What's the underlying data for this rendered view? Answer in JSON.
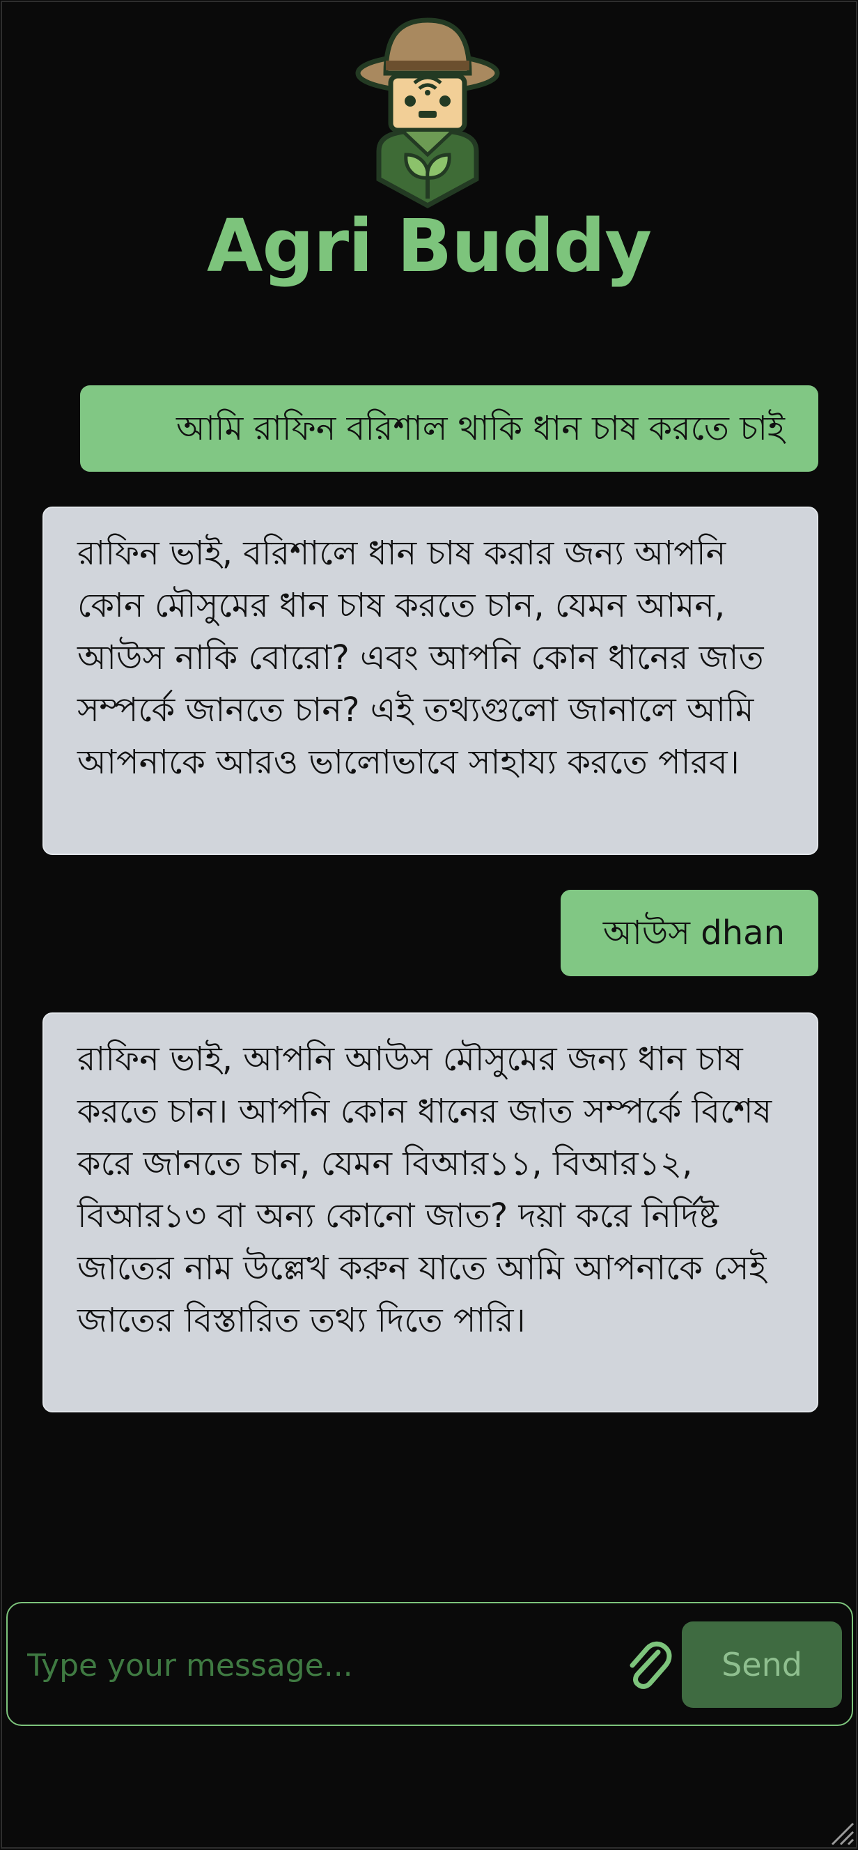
{
  "app": {
    "title": "Agri Buddy",
    "logo_icon": "farmer-robot-icon",
    "accent_color": "#7dc47c",
    "background_color": "#0a0a0a"
  },
  "messages": [
    {
      "role": "user",
      "text": "আমি রাফিন বরিশাল থাকি ধান চাষ করতে চাই"
    },
    {
      "role": "bot",
      "text": "রাফিন ভাই, বরিশালে ধান চাষ করার জন্য আপনি কোন মৌসুমের ধান চাষ করতে চান, যেমন আমন, আউস নাকি বোরো? এবং আপনি কোন ধানের জাত সম্পর্কে জানতে চান? এই তথ্যগুলো জানালে আমি আপনাকে আরও ভালোভাবে সাহায্য করতে পারব।"
    },
    {
      "role": "user",
      "text": "আউস dhan"
    },
    {
      "role": "bot",
      "text": "রাফিন ভাই, আপনি আউস মৌসুমের জন্য ধান চাষ করতে চান। আপনি কোন ধানের জাত সম্পর্কে বিশেষ করে জানতে চান, যেমন বিআর১১, বিআর১২, বিআর১৩ বা অন্য কোনো জাত? দয়া করে নির্দিষ্ট জাতের নাম উল্লেখ করুন যাতে আমি আপনাকে সেই জাতের বিস্তারিত তথ্য দিতে পারি।"
    }
  ],
  "composer": {
    "placeholder": "Type your message...",
    "value": "",
    "attach_icon": "paperclip-icon",
    "send_label": "Send"
  }
}
